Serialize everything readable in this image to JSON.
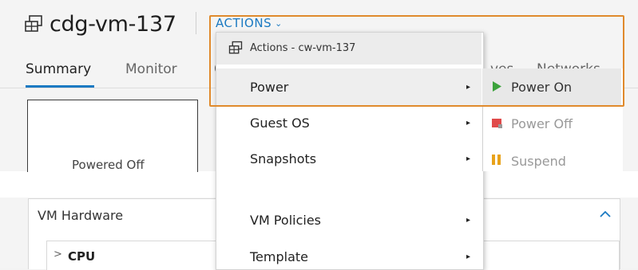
{
  "header": {
    "vm_name": "cdg-vm-137",
    "actions_label": "ACTIONS",
    "actions_chevron": "⌄"
  },
  "tabs": {
    "summary": "Summary",
    "monitor": "Monitor",
    "third_partial": "C",
    "partial": "ves",
    "networks": "Networks"
  },
  "vm_box": {
    "status": "Powered Off"
  },
  "hardware": {
    "title": "VM Hardware",
    "collapse_icon": "^",
    "cpu_label": "CPU",
    "cpu_chevron": ">"
  },
  "actions_menu": {
    "header_label": "Actions - cw-vm-137",
    "items": [
      {
        "label": "Power",
        "arrow": "▸"
      },
      {
        "label": "Guest OS",
        "arrow": "▸"
      },
      {
        "label": "Snapshots",
        "arrow": "▸"
      },
      {
        "label": "VM Policies",
        "arrow": "▸"
      },
      {
        "label": "Template",
        "arrow": "▸"
      }
    ]
  },
  "power_submenu": {
    "items": [
      {
        "label": "Power On",
        "icon": "play-icon",
        "color": "#333333"
      },
      {
        "label": "Power Off",
        "icon": "power-off-icon",
        "color": "#999999"
      },
      {
        "label": "Suspend",
        "icon": "suspend-icon",
        "color": "#999999"
      }
    ]
  },
  "colors": {
    "accent": "#1b7ac2",
    "highlight": "#e08a2c",
    "power_on_green": "#3ca33c",
    "power_off_red": "#e04a4a",
    "suspend_yellow": "#e8a21a"
  }
}
